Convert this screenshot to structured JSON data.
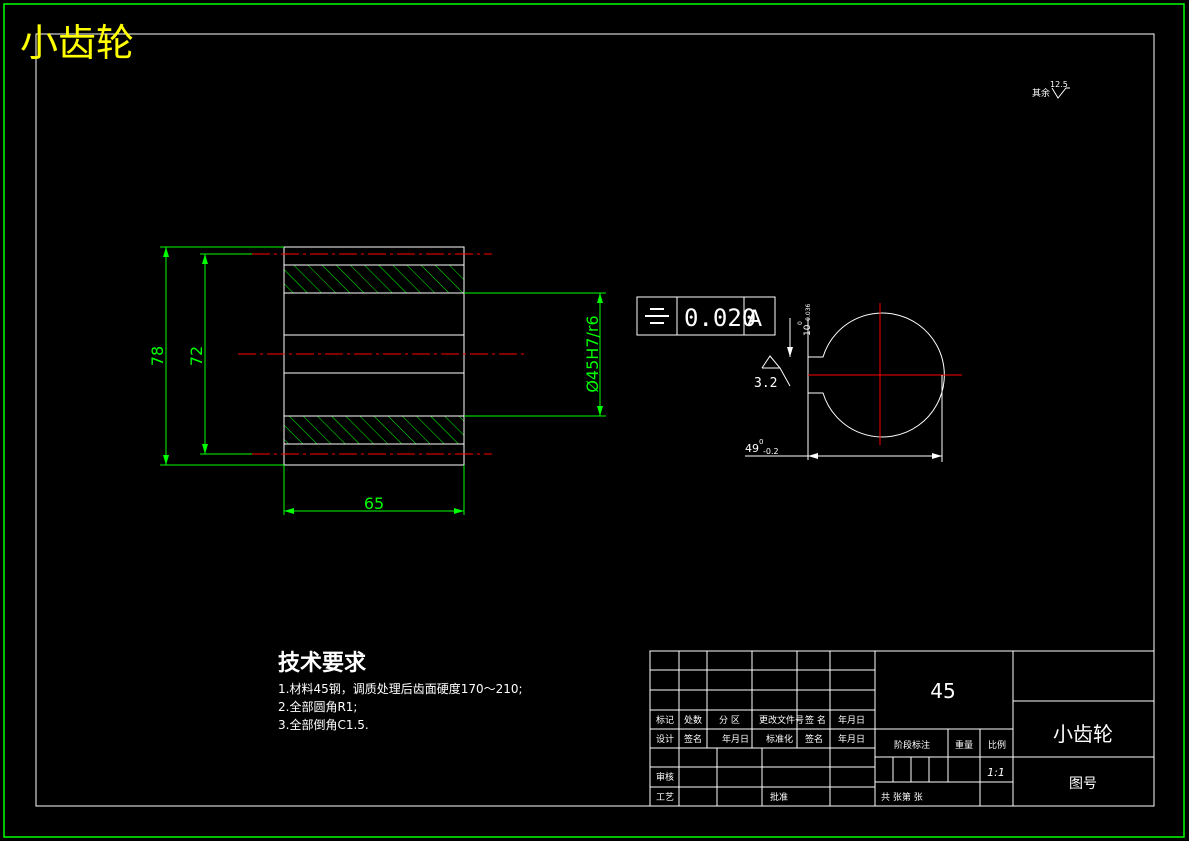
{
  "header": {
    "title": "小齿轮"
  },
  "surface_finish_note": {
    "prefix": "其余",
    "value": "12.5"
  },
  "drawing": {
    "dims": {
      "outer_height": "78",
      "inner_height": "72",
      "bore": "Ø45H7/r6",
      "width": "65"
    },
    "tolerance_frame": {
      "symbol": "⌯",
      "value": "0.020",
      "datum": "A"
    },
    "keyway": {
      "width_dim": "10",
      "width_tol_upper": "0",
      "width_tol_lower": "-0.036",
      "depth_dim": "49",
      "depth_tol_upper": "0",
      "depth_tol_lower": "-0.2",
      "roughness": "3.2"
    }
  },
  "tech_requirements": {
    "heading": "技术要求",
    "items": [
      "1.材料45钢，调质处理后齿面硬度170～210;",
      "2.全部圆角R1;",
      "3.全部倒角C1.5."
    ]
  },
  "title_block": {
    "material": "45",
    "part_name": "小齿轮",
    "drawing_no_label": "图号",
    "scale": "1:1",
    "labels": {
      "row_mark": "标记",
      "row_count": "处数",
      "row_zone": "分 区",
      "row_doc": "更改文件号",
      "row_sign": "签 名",
      "row_date": "年月日",
      "design": "设计",
      "sign2": "签名",
      "date2": "年月日",
      "std": "标准化",
      "sign3": "签名",
      "date3": "年月日",
      "stage_mark": "阶段标注",
      "weight": "重量",
      "scale": "比例",
      "review": "审核",
      "process": "工艺",
      "approve": "批准",
      "sheets": "共  张第  张"
    }
  },
  "colors": {
    "border": "#00ff00",
    "lines": "#ffffff",
    "dims": "#00ff00",
    "center": "#ff0000",
    "title": "#ffff00"
  }
}
